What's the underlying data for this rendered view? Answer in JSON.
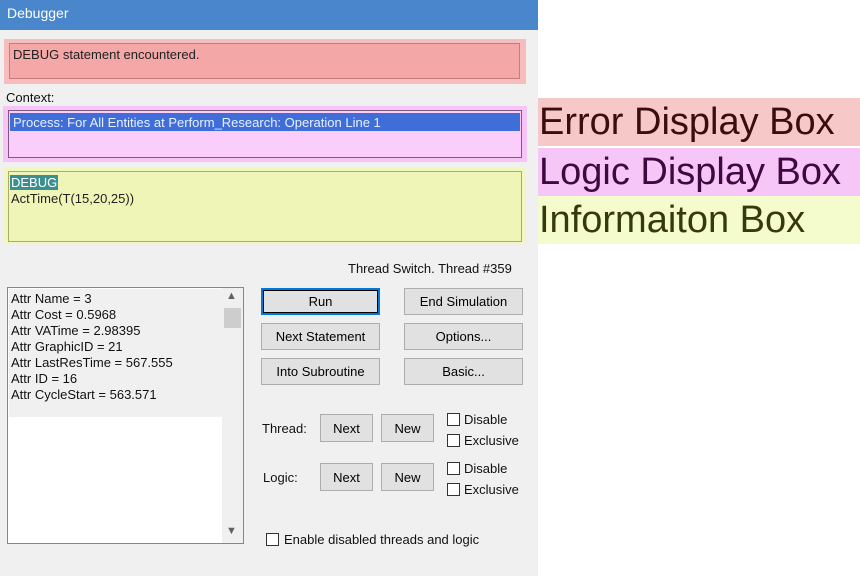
{
  "window": {
    "title": "Debugger"
  },
  "error_box": {
    "message": "DEBUG statement encountered."
  },
  "context": {
    "label": "Context:",
    "logic_line": "Process: For All Entities at Perform_Research: Operation Line 1"
  },
  "info_box": {
    "highlight": "DEBUG",
    "statement": "ActTime(T(15,20,25))"
  },
  "thread_switch": "Thread Switch. Thread #359",
  "attributes": [
    "Attr Name = 3",
    "Attr Cost = 0.5968",
    "Attr VATime = 2.98395",
    "Attr GraphicID = 21",
    "Attr LastResTime = 567.555",
    "Attr ID = 16",
    "Attr CycleStart = 563.571"
  ],
  "buttons": {
    "run": "Run",
    "end_simulation": "End Simulation",
    "next_statement": "Next Statement",
    "options": "Options...",
    "into_subroutine": "Into Subroutine",
    "basic": "Basic..."
  },
  "thread": {
    "label": "Thread:",
    "next": "Next",
    "new": "New",
    "disable": "Disable",
    "exclusive": "Exclusive"
  },
  "logic": {
    "label": "Logic:",
    "next": "Next",
    "new": "New",
    "disable": "Disable",
    "exclusive": "Exclusive"
  },
  "enable_disabled": "Enable disabled threads and logic",
  "annotations": {
    "error": "Error Display Box",
    "logic": "Logic Display Box",
    "info": "Informaiton Box"
  },
  "icons": {
    "scroll_up": "chevron-up-icon",
    "scroll_down": "chevron-down-icon"
  }
}
